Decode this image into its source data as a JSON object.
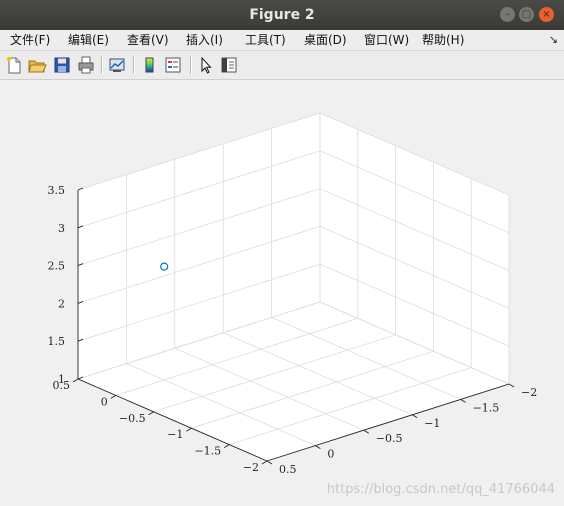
{
  "window": {
    "title": "Figure 2"
  },
  "window_buttons": {
    "minimize": "–",
    "maximize": "□",
    "close": "×"
  },
  "menubar": {
    "items": [
      "文件(F)",
      "编辑(E)",
      "查看(V)",
      "插入(I)",
      "工具(T)",
      "桌面(D)",
      "窗口(W)",
      "帮助(H)"
    ],
    "overflow_icon": "↘"
  },
  "toolbar": {
    "buttons": [
      "new-figure-icon",
      "open-file-icon",
      "save-icon",
      "print-icon",
      "link-plot-icon",
      "insert-colorbar-icon",
      "insert-legend-icon",
      "edit-plot-arrow-icon",
      "property-inspector-icon"
    ]
  },
  "colors": {
    "marker": "#0072bd",
    "grid": "#dcdcdc",
    "axis": "#262626"
  },
  "chart_data": {
    "type": "scatter",
    "projection": "3d",
    "series": [
      {
        "x": [
          0
        ],
        "y": [
          0
        ],
        "z": [
          2.5
        ]
      }
    ],
    "xlim": [
      -2,
      0.5
    ],
    "ylim": [
      -2,
      0.5
    ],
    "zlim": [
      1,
      3.5
    ],
    "x_ticks": [
      "−2",
      "−1.5",
      "−1",
      "−0.5",
      "0",
      "0.5"
    ],
    "y_ticks": [
      "−2",
      "−1.5",
      "−1",
      "−0.5",
      "0",
      "0.5"
    ],
    "z_ticks": [
      "1",
      "1.5",
      "2",
      "2.5",
      "3",
      "3.5"
    ],
    "grid": true,
    "marker": "circle"
  },
  "watermark": "https://blog.csdn.net/qq_41766044"
}
